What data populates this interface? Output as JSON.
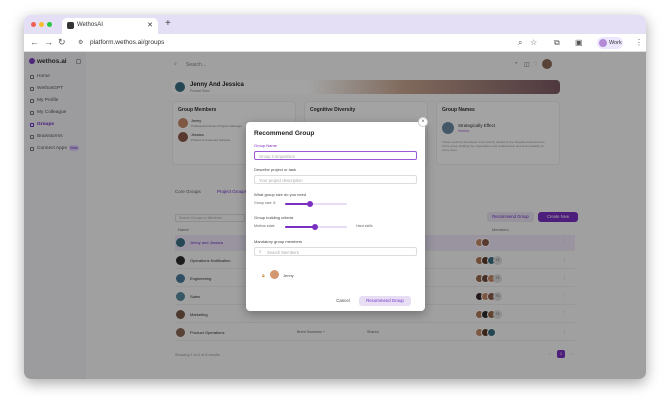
{
  "browser": {
    "tab_title": "WethosAI",
    "url": "platform.wethos.ai/groups",
    "profile_label": "Work"
  },
  "sidebar": {
    "brand": "wethos.ai",
    "items": [
      {
        "label": "Home",
        "icon": "home-icon",
        "active": false
      },
      {
        "label": "WethosGPT",
        "icon": "chat-icon",
        "active": false
      },
      {
        "label": "My Profile",
        "icon": "user-icon",
        "active": false
      },
      {
        "label": "My Colleague",
        "icon": "users-icon",
        "active": false
      },
      {
        "label": "Groups",
        "icon": "groups-icon",
        "active": true
      },
      {
        "label": "Brainstorms",
        "icon": "bulb-icon",
        "active": false
      },
      {
        "label": "Connect Apps",
        "icon": "plug-icon",
        "active": false,
        "badge": "Beta"
      }
    ]
  },
  "main": {
    "search_placeholder": "Search...",
    "banner_title": "Jenny And Jessica",
    "banner_subtitle": "Product Team",
    "cards": {
      "members_title": "Group Members",
      "diversity_title": "Cognitive Diversity",
      "names_title": "Group Names",
      "members": [
        {
          "name": "Jenny",
          "role": "Professional Senior Program Manager"
        },
        {
          "name": "Jessica",
          "role": "Product & Customer Success"
        }
      ],
      "group_name": "Strategically Effect",
      "group_name_sub": "Mantra",
      "group_name_desc": "These could be developed to be directly related to the integrated assessment of the group building the organization and collaboration and accountability on every team."
    },
    "view_tabs": [
      "Core Groups",
      "Project Groups"
    ],
    "recommend_button": "Recommend Group",
    "create_button": "Create New",
    "table_search_placeholder": "Search Groups or Members",
    "columns": [
      "Name",
      "Members"
    ],
    "rows": [
      {
        "name": "Jenny and Jessica",
        "extra": "",
        "members_more": ""
      },
      {
        "name": "Operations Notification",
        "extra": "",
        "members_more": "+2"
      },
      {
        "name": "Engineering",
        "extra": "",
        "members_more": "+2"
      },
      {
        "name": "Sales",
        "extra": "",
        "members_more": "+2"
      },
      {
        "name": "Marketing",
        "extra": "",
        "members_more": "+2"
      },
      {
        "name": "Product Operations",
        "extra": "Brent Summers +",
        "status": "Shared",
        "members_more": ""
      }
    ],
    "showing_text": "Showing 1 to 6 of 6 results",
    "pages": [
      "1"
    ]
  },
  "modal": {
    "title": "Recommend Group",
    "group_name_label": "Group Name",
    "group_name_placeholder": "Group Composition",
    "describe_label": "Describe project or task",
    "describe_placeholder": "Your project description",
    "size_label": "What group size do you need",
    "size_text": "Group size: 8",
    "size_value": 8,
    "size_fraction": 0.41,
    "criteria_label": "Group building criteria",
    "criteria_left": "Methos state",
    "criteria_right": "Hard skills",
    "criteria_fraction": 0.49,
    "mandatory_label": "Mandatory group members",
    "member_search_placeholder": "Search Members",
    "selected_member": "Jenny",
    "cancel_label": "Cancel",
    "submit_label": "Recommend Group"
  }
}
